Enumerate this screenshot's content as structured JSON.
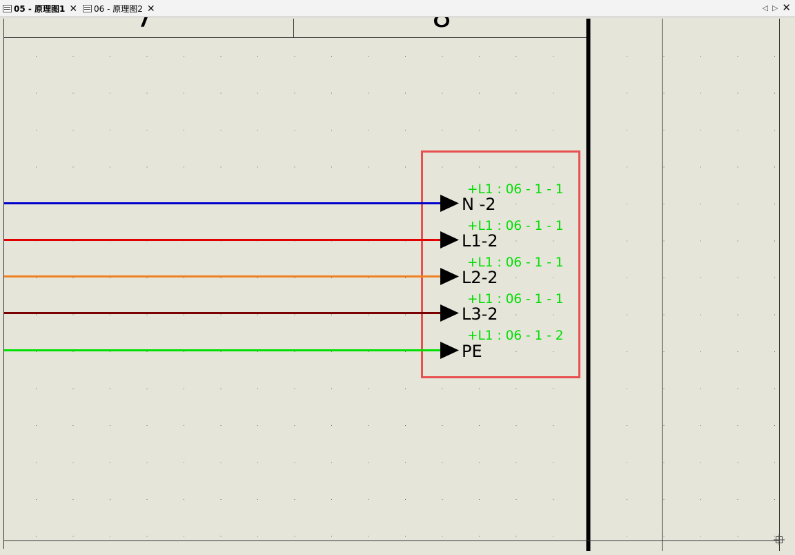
{
  "tabs": [
    {
      "label": "05 - 原理图1",
      "active": true,
      "icon": "schematic-page-icon",
      "close": "✕"
    },
    {
      "label": "06 - 原理图2",
      "active": false,
      "icon": "schematic-page-icon",
      "close": "✕"
    }
  ],
  "nav": {
    "prev": "◁",
    "next": "▷",
    "close": "✕"
  },
  "colors": {
    "background": "#e6e5da",
    "highlight_box": "#e85050",
    "reference_text": "#00dd00",
    "N": "#0000cc",
    "L1": "#e00000",
    "L2": "#f08020",
    "L3": "#7a0000",
    "PE": "#00e000"
  },
  "header_columns": [
    {
      "label": "7"
    },
    {
      "label": "8"
    }
  ],
  "connectors": [
    {
      "name": "N -2",
      "ref": "+L1 : 06 - 1 - 1",
      "color": "#0000cc"
    },
    {
      "name": "L1-2",
      "ref": "+L1 : 06 - 1 - 1",
      "color": "#e00000"
    },
    {
      "name": "L2-2",
      "ref": "+L1 : 06 - 1 - 1",
      "color": "#f08020"
    },
    {
      "name": "L3-2",
      "ref": "+L1 : 06 - 1 - 1",
      "color": "#7a0000"
    },
    {
      "name": "PE",
      "ref": "+L1 : 06 - 1 - 2",
      "color": "#00e000"
    }
  ]
}
